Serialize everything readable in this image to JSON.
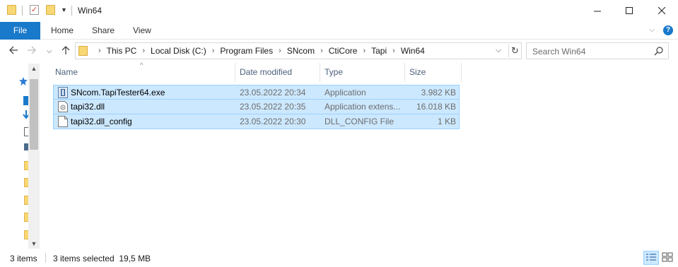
{
  "window": {
    "title": "Win64",
    "controls": [
      "minimize-icon",
      "maximize-icon",
      "close-icon"
    ]
  },
  "ribbon": {
    "tabs": [
      {
        "label": "File",
        "active": true
      },
      {
        "label": "Home"
      },
      {
        "label": "Share"
      },
      {
        "label": "View"
      }
    ],
    "help_label": "?"
  },
  "address": {
    "breadcrumbs": [
      "This PC",
      "Local Disk (C:)",
      "Program Files",
      "SNcom",
      "CtiCore",
      "Tapi",
      "Win64"
    ]
  },
  "search": {
    "placeholder": "Search Win64"
  },
  "columns": [
    {
      "label": "Name"
    },
    {
      "label": "Date modified"
    },
    {
      "label": "Type"
    },
    {
      "label": "Size"
    }
  ],
  "files": [
    {
      "name": "SNcom.TapiTester64.exe",
      "date": "23.05.2022 20:34",
      "type": "Application",
      "size": "3.982 KB",
      "icon": "exe-icon",
      "selected": true
    },
    {
      "name": "tapi32.dll",
      "date": "23.05.2022 20:35",
      "type": "Application extens...",
      "size": "16.018 KB",
      "icon": "dll-icon",
      "selected": true
    },
    {
      "name": "tapi32.dll_config",
      "date": "23.05.2022 20:30",
      "type": "DLL_CONFIG File",
      "size": "1 KB",
      "icon": "file-icon",
      "selected": true
    }
  ],
  "status": {
    "item_count": "3 items",
    "selection": "3 items selected  19,5 MB"
  },
  "colors": {
    "accent": "#1979ca",
    "selection_bg": "#cce8ff",
    "selection_border": "#99d1ff",
    "header_text": "#4c607a"
  }
}
